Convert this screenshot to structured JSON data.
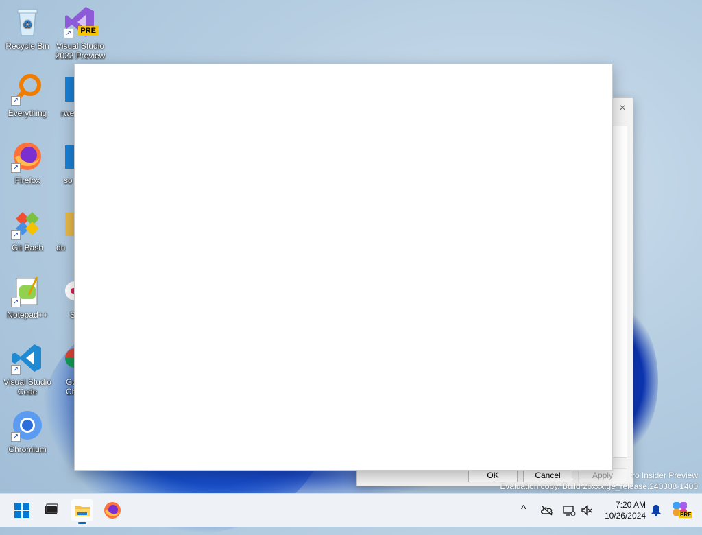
{
  "desktop": {
    "icons": [
      {
        "label": "Recycle Bin"
      },
      {
        "label": "Visual Studio 2022 Preview",
        "badge": "PRE"
      },
      {
        "label": "Everything"
      },
      {
        "label": "rwe"
      },
      {
        "label": "Firefox"
      },
      {
        "label": "so"
      },
      {
        "label": "Git Bash"
      },
      {
        "label": "dn"
      },
      {
        "label": "Notepad++"
      },
      {
        "label": "S"
      },
      {
        "label": "Visual Studio Code"
      },
      {
        "label": "Go Ch"
      },
      {
        "label": "Chromium"
      }
    ]
  },
  "background_dialog": {
    "close_glyph": "×",
    "ok_label": "OK",
    "cancel_label": "Cancel",
    "apply_label": "Apply"
  },
  "watermark": {
    "line1": "ro Insider Preview",
    "line2": "Evaluation copy. Build 26xxx.ge_release.240308-1400"
  },
  "taskbar": {
    "apps": [
      "start-icon",
      "task-view-icon",
      "file-explorer-icon",
      "firefox-icon"
    ],
    "tray": {
      "chevron": "^",
      "time": "7:20 AM",
      "date": "10/26/2024"
    },
    "copilot_badge": "PRE"
  },
  "colors": {
    "accent": "#0067c0",
    "wallpaper_blue": "#1450c8"
  }
}
